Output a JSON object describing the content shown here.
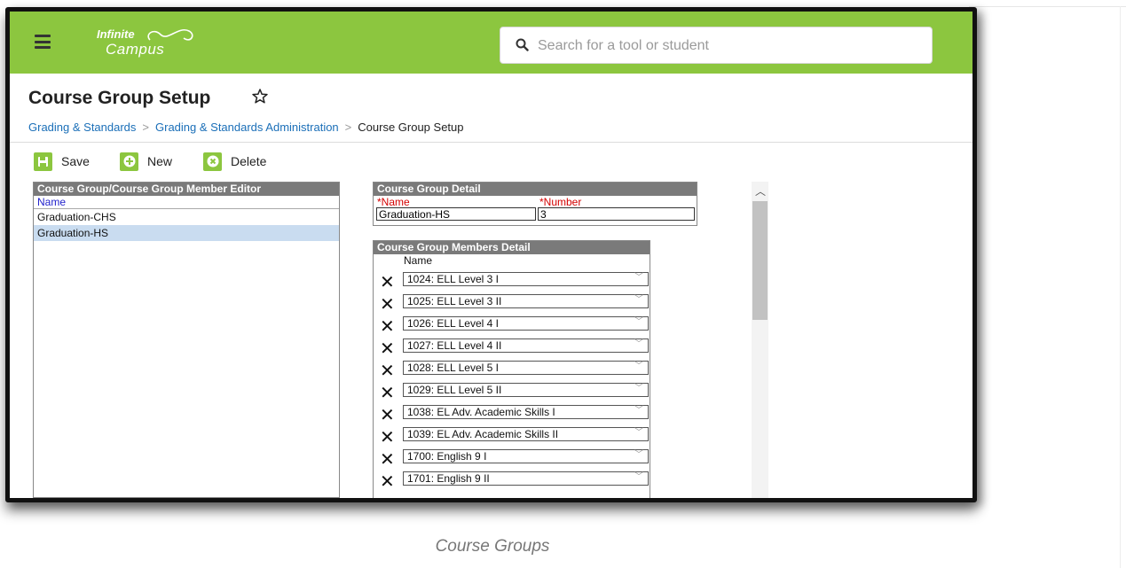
{
  "app": {
    "logo_top": "Infinite",
    "logo_bottom": "Campus",
    "search_placeholder": "Search for a tool or student"
  },
  "page": {
    "title": "Course Group Setup",
    "breadcrumb": [
      "Grading & Standards",
      "Grading & Standards Administration",
      "Course Group Setup"
    ]
  },
  "toolbar": {
    "save_label": "Save",
    "new_label": "New",
    "delete_label": "Delete"
  },
  "editor": {
    "header": "Course Group/Course Group Member Editor",
    "column": "Name",
    "rows": [
      "Graduation-CHS",
      "Graduation-HS"
    ],
    "selected": "Graduation-HS"
  },
  "detail": {
    "header": "Course Group Detail",
    "name_label": "*Name",
    "number_label": "*Number",
    "name_value": "Graduation-HS",
    "number_value": "3"
  },
  "members": {
    "header": "Course Group Members Detail",
    "column": "Name",
    "items": [
      "1024: ELL Level 3 I",
      "1025: ELL Level 3 II",
      "1026: ELL Level 4 I",
      "1027: ELL Level 4 II",
      "1028: ELL Level 5 I",
      "1029: ELL Level 5 II",
      "1038: EL Adv. Academic Skills I",
      "1039: EL Adv. Academic Skills II",
      "1700: English 9 I",
      "1701: English 9 II"
    ]
  },
  "caption": "Course Groups",
  "colors": {
    "brand_green": "#8cc63f",
    "link_blue": "#1b6fb8",
    "required_red": "#d40000",
    "panel_header": "#7a7a7a",
    "selected_row": "#c9dcf0"
  }
}
